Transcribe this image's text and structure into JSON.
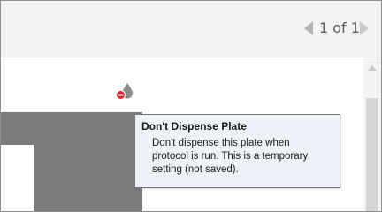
{
  "pager": {
    "label": "1 of 1",
    "prev_icon": "chevron-left-icon",
    "next_icon": "chevron-right-icon"
  },
  "plate_toggle": {
    "icon": "dispense-drop-with-stop-icon",
    "drop_color": "#8a8a8a",
    "stop_color": "#e02020"
  },
  "tooltip": {
    "title": "Don't Dispense Plate",
    "lines": [
      "Don't dispense this plate when",
      "protocol is run. This is a temporary",
      "setting (not saved)."
    ]
  },
  "colors": {
    "toolbar_bg": "#f3f3f3",
    "plate_gray": "#7b7b7b",
    "tooltip_bg": "#eef1f8"
  }
}
